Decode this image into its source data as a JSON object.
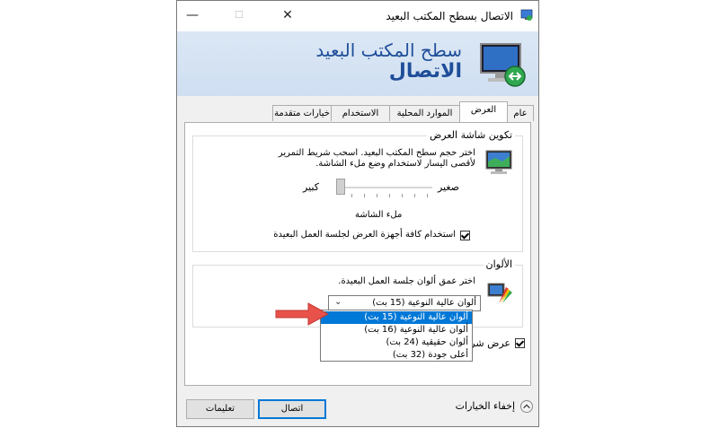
{
  "window": {
    "title": "الاتصال بسطح المكتب البعيد",
    "controls": {
      "minimize": "—",
      "maximize": "☐",
      "close": "✕"
    }
  },
  "banner": {
    "subtitle": "سطح المكتب البعيد",
    "title": "الاتصال"
  },
  "tabs": [
    {
      "label": "عام"
    },
    {
      "label": "العرض",
      "active": true
    },
    {
      "label": "الموارد المحلية"
    },
    {
      "label": "الاستخدام"
    },
    {
      "label": "خيارات متقدمة"
    }
  ],
  "display_config": {
    "group_title": "تكوين شاشة العرض",
    "description": "اختر حجم سطح المكتب البعيد. اسحب شريط التمرير لأقصى اليسار لاستخدام وضع ملء الشاشة.",
    "slider_small_label": "صغير",
    "slider_large_label": "كبير",
    "slider_value_label": "ملء الشاشة",
    "multi_monitor_checkbox": "استخدام كافة أجهزة العرض لجلسة العمل البعيدة"
  },
  "colors": {
    "group_title": "الألوان",
    "description": "اختر عمق ألوان جلسة العمل البعيدة.",
    "selected_value": "ألوان عالية النوعية (15 بت)",
    "options": [
      "ألوان عالية النوعية (15 بت)",
      "ألوان عالية النوعية (16 بت)",
      "ألوان حقيقية (24 بت)",
      "أعلى جودة (32 بت)"
    ]
  },
  "connection_bar": {
    "checkbox_label": "عرض شريط"
  },
  "footer": {
    "hide_options": "إخفاء الخيارات",
    "connect_button": "اتصال",
    "help_button": "تعليمات"
  },
  "accent": "#0078d7",
  "annotation_arrow_color": "#e8524a"
}
